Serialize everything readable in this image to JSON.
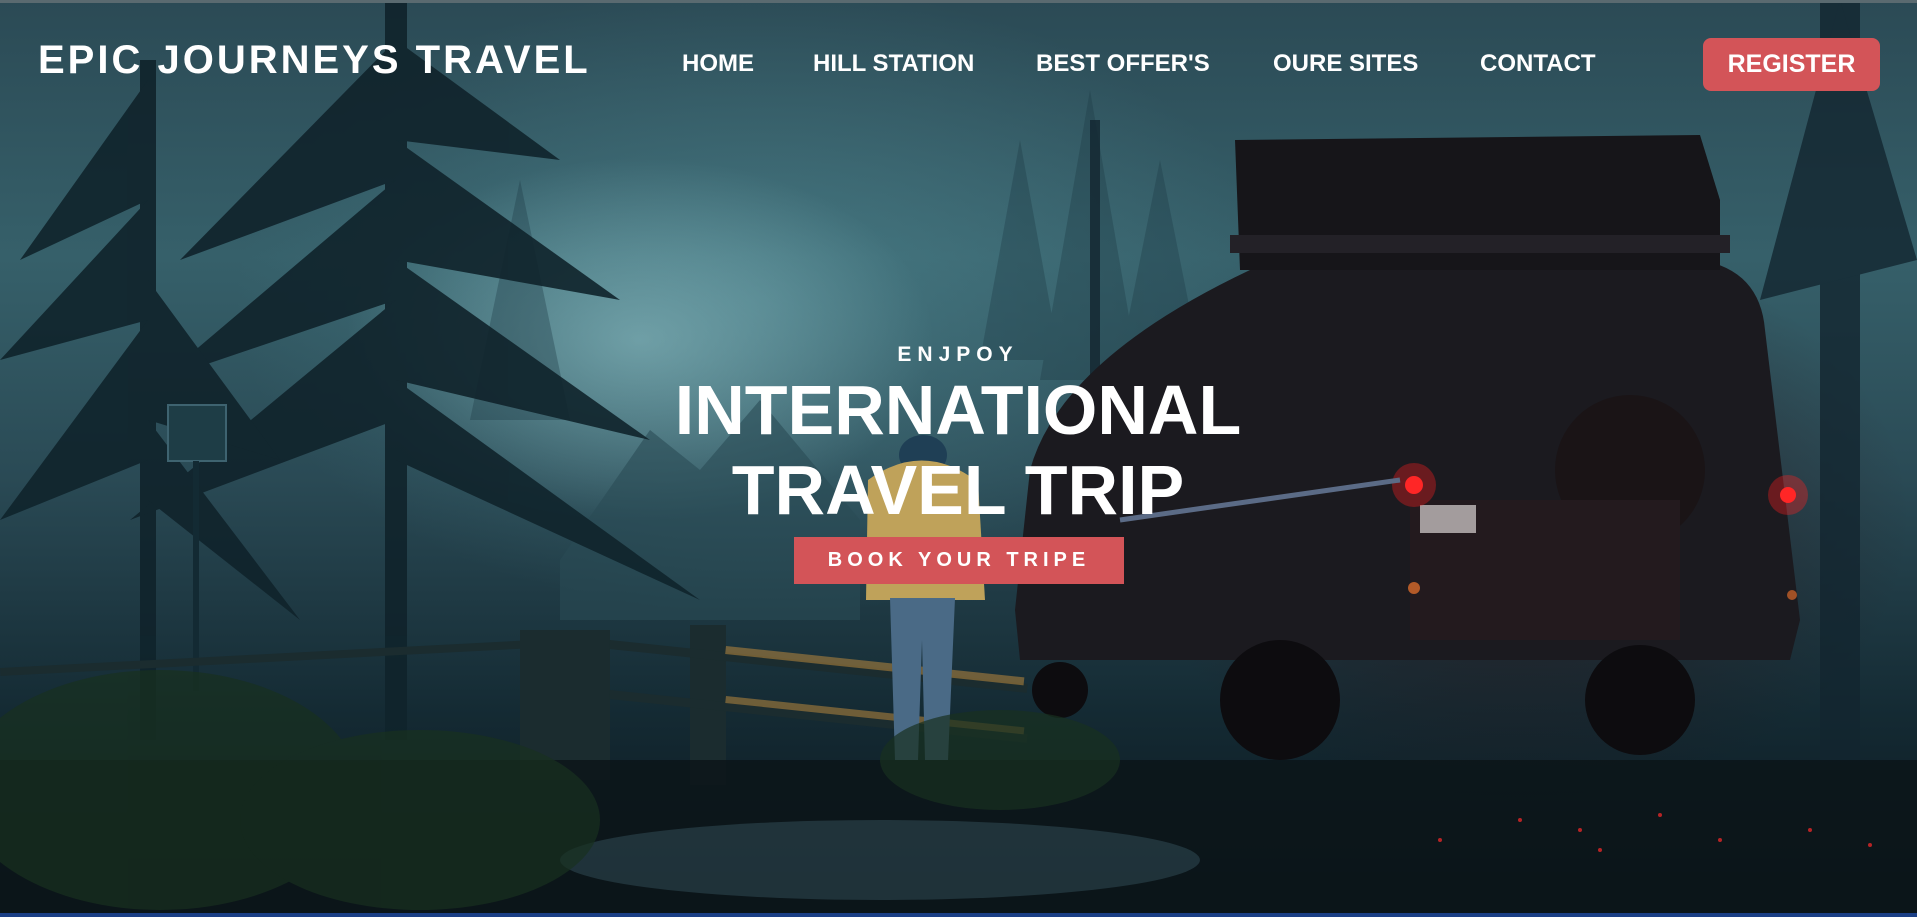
{
  "brand": {
    "name": "EPIC JOURNEYS TRAVEL"
  },
  "nav": {
    "items": [
      {
        "label": "HOME"
      },
      {
        "label": "HILL STATION"
      },
      {
        "label": "BEST OFFER'S"
      },
      {
        "label": "OURE SITES"
      },
      {
        "label": "CONTACT"
      }
    ],
    "register_label": "REGISTER"
  },
  "hero": {
    "eyebrow": "ENJPOY",
    "title_line_1": "INTERNATIONAL",
    "title_line_2": "TRAVEL TRIP",
    "cta_label": "BOOK YOUR TRIPE",
    "background_description_icon": "night-forest-jeep-photo"
  },
  "colors": {
    "accent": "#d35458",
    "text": "#ffffff"
  }
}
